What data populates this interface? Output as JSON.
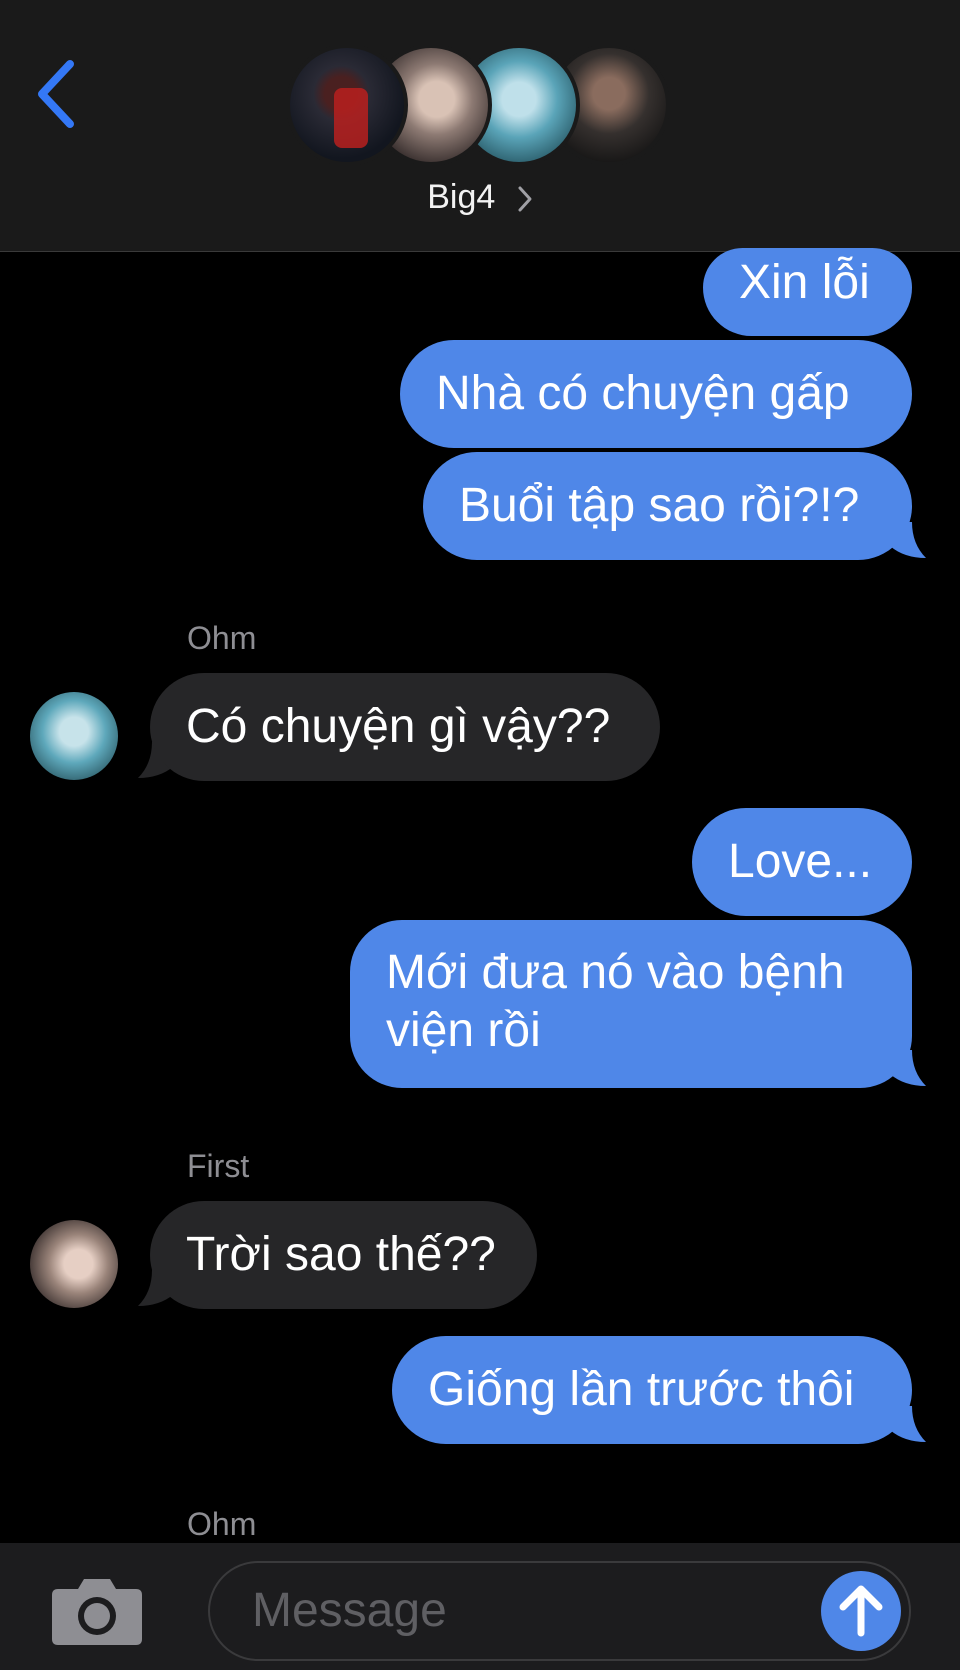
{
  "header": {
    "back_icon": "chevron-left-icon",
    "group_name": "Big4",
    "accent_color": "#3478f6"
  },
  "messages": [
    {
      "type": "outgoing",
      "text": "Xin lỗi"
    },
    {
      "type": "outgoing",
      "text": "Nhà có chuyện gấp"
    },
    {
      "type": "outgoing",
      "text": "Buổi tập sao rồi?!?"
    },
    {
      "type": "incoming",
      "sender": "Ohm",
      "text": "Có chuyện gì vậy??"
    },
    {
      "type": "outgoing",
      "text": "Love..."
    },
    {
      "type": "outgoing",
      "text_line1": "Mới đưa nó vào bệnh",
      "text_line2": "viện rồi"
    },
    {
      "type": "incoming",
      "sender": "First",
      "text": "Trời sao thế??"
    },
    {
      "type": "outgoing",
      "text": "Giống lần trước thôi"
    },
    {
      "type": "sender_label",
      "sender": "Ohm"
    }
  ],
  "composer": {
    "placeholder": "Message",
    "camera_icon": "camera-icon",
    "send_icon": "arrow-up-icon"
  },
  "colors": {
    "outgoing_bubble": "#4f87e8",
    "incoming_bubble": "#262628",
    "background": "#000000"
  }
}
